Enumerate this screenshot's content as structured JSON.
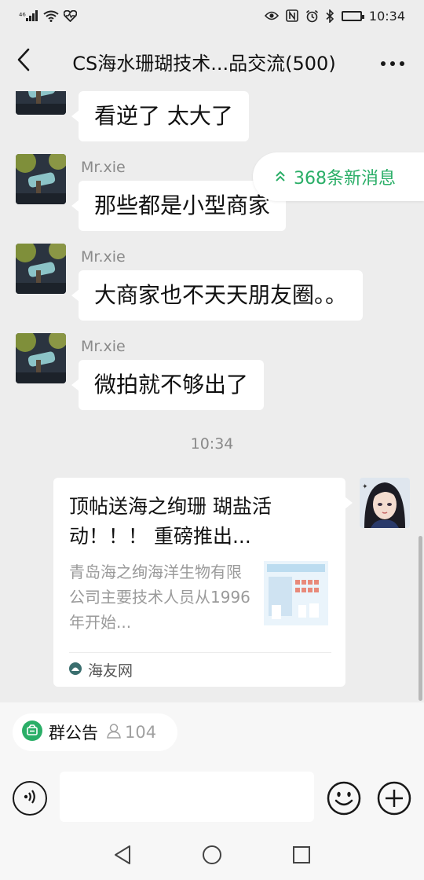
{
  "status_bar": {
    "network": "⁴⁶",
    "time": "10:34",
    "battery_level": 0.9
  },
  "nav": {
    "title": "CS海水珊瑚技术...品交流(500)"
  },
  "messages": [
    {
      "sender": "",
      "text": "看逆了 太大了"
    },
    {
      "sender": "Mr.xie",
      "text": "那些都是小型商家"
    },
    {
      "sender": "Mr.xie",
      "text": "大商家也不天天朋友圈。。"
    },
    {
      "sender": "Mr.xie",
      "text": "微拍就不够出了"
    }
  ],
  "new_messages": {
    "label": "368条新消息",
    "accent": "#2aae67"
  },
  "timestamp": "10:34",
  "link_card": {
    "title": "顶帖送海之绚珊 瑚盐活动！！！ 重磅推出...",
    "description": "青岛海之绚海洋生物有限公司主要技术人员从1996年开始...",
    "source": "海友网"
  },
  "announcement": {
    "label": "群公告",
    "count": "104",
    "icon_color": "#2aae67"
  },
  "input": {
    "value": "",
    "placeholder": ""
  },
  "icons": {
    "back": "chevron-left-icon",
    "more": "more-icon",
    "voice": "voice-icon",
    "emoji": "emoji-icon",
    "plus": "plus-icon"
  }
}
